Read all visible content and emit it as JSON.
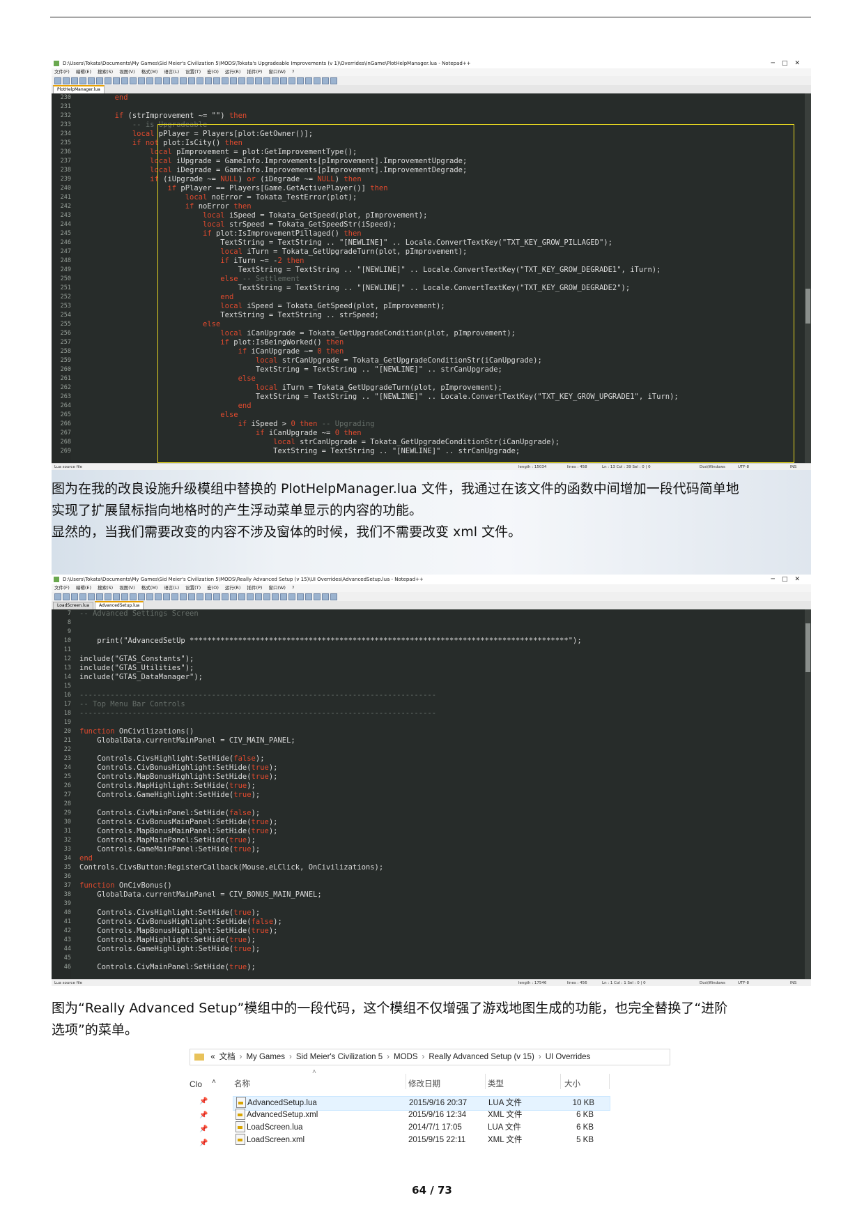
{
  "screenshot1": {
    "title": "D:\\Users\\Tokata\\Documents\\My Games\\Sid Meier's Civilization 5\\MODS\\Tokata's Upgradeable Improvements (v 1)\\Overrides\\InGame\\PlotHelpManager.lua - Notepad++",
    "menu": [
      "文件(F)",
      "编辑(E)",
      "搜索(S)",
      "视图(V)",
      "格式(M)",
      "语言(L)",
      "设置(T)",
      "宏(O)",
      "运行(R)",
      "插件(P)",
      "窗口(W)",
      "?"
    ],
    "tabs": [
      "PlotHelpManager.lua"
    ],
    "line_numbers": [
      "230",
      "231",
      "232",
      "233",
      "234",
      "235",
      "236",
      "237",
      "238",
      "239",
      "240",
      "241",
      "242",
      "243",
      "244",
      "245",
      "246",
      "247",
      "248",
      "249",
      "250",
      "251",
      "252",
      "253",
      "254",
      "255",
      "256",
      "257",
      "258",
      "259",
      "260",
      "261",
      "262",
      "263",
      "264",
      "265",
      "266",
      "267",
      "268",
      "269"
    ],
    "code": [
      "\t\tend",
      "",
      "\t\tif (strImprovement ~= \"\") then",
      "\t\t\t-- is Upgradeable",
      "\t\t\tlocal pPlayer = Players[plot:GetOwner()];",
      "\t\t\tif not plot:IsCity() then",
      "\t\t\t\tlocal pImprovement = plot:GetImprovementType();",
      "\t\t\t\tlocal iUpgrade = GameInfo.Improvements[pImprovement].ImprovementUpgrade;",
      "\t\t\t\tlocal iDegrade = GameInfo.Improvements[pImprovement].ImprovementDegrade;",
      "\t\t\t\tif (iUpgrade ~= NULL) or (iDegrade ~= NULL) then",
      "\t\t\t\t\tif pPlayer == Players[Game.GetActivePlayer()] then",
      "\t\t\t\t\t\tlocal noError = Tokata_TestError(plot);",
      "\t\t\t\t\t\tif noError then",
      "\t\t\t\t\t\t\tlocal iSpeed = Tokata_GetSpeed(plot, pImprovement);",
      "\t\t\t\t\t\t\tlocal strSpeed = Tokata_GetSpeedStr(iSpeed);",
      "\t\t\t\t\t\t\tif plot:IsImprovementPillaged() then",
      "\t\t\t\t\t\t\t\tTextString = TextString .. \"[NEWLINE]\" .. Locale.ConvertTextKey(\"TXT_KEY_GROW_PILLAGED\");",
      "\t\t\t\t\t\t\t\tlocal iTurn = Tokata_GetUpgradeTurn(plot, pImprovement);",
      "\t\t\t\t\t\t\t\tif iTurn ~= -2 then",
      "\t\t\t\t\t\t\t\t\tTextString = TextString .. \"[NEWLINE]\" .. Locale.ConvertTextKey(\"TXT_KEY_GROW_DEGRADE1\", iTurn);",
      "\t\t\t\t\t\t\t\telse -- Settlement",
      "\t\t\t\t\t\t\t\t\tTextString = TextString .. \"[NEWLINE]\" .. Locale.ConvertTextKey(\"TXT_KEY_GROW_DEGRADE2\");",
      "\t\t\t\t\t\t\t\tend",
      "\t\t\t\t\t\t\t\tlocal iSpeed = Tokata_GetSpeed(plot, pImprovement);",
      "\t\t\t\t\t\t\t\tTextString = TextString .. strSpeed;",
      "\t\t\t\t\t\t\telse",
      "\t\t\t\t\t\t\t\tlocal iCanUpgrade = Tokata_GetUpgradeCondition(plot, pImprovement);",
      "\t\t\t\t\t\t\t\tif plot:IsBeingWorked() then",
      "\t\t\t\t\t\t\t\t\tif iCanUpgrade ~= 0 then",
      "\t\t\t\t\t\t\t\t\t\tlocal strCanUpgrade = Tokata_GetUpgradeConditionStr(iCanUpgrade);",
      "\t\t\t\t\t\t\t\t\t\tTextString = TextString .. \"[NEWLINE]\" .. strCanUpgrade;",
      "\t\t\t\t\t\t\t\t\telse",
      "\t\t\t\t\t\t\t\t\t\tlocal iTurn = Tokata_GetUpgradeTurn(plot, pImprovement);",
      "\t\t\t\t\t\t\t\t\t\tTextString = TextString .. \"[NEWLINE]\" .. Locale.ConvertTextKey(\"TXT_KEY_GROW_UPGRADE1\", iTurn);",
      "\t\t\t\t\t\t\t\t\tend",
      "\t\t\t\t\t\t\t\telse",
      "\t\t\t\t\t\t\t\t\tif iSpeed > 0 then -- Upgrading",
      "\t\t\t\t\t\t\t\t\t\tif iCanUpgrade ~= 0 then",
      "\t\t\t\t\t\t\t\t\t\t\tlocal strCanUpgrade = Tokata_GetUpgradeConditionStr(iCanUpgrade);",
      "\t\t\t\t\t\t\t\t\t\t\tTextString = TextString .. \"[NEWLINE]\" .. strCanUpgrade;"
    ],
    "status": {
      "left": "Lua source file",
      "length": "length : 15034",
      "lines": "lines : 458",
      "pos": "Ln : 13    Col : 39    Sel : 0 | 0",
      "eol": "Dos\\Windows",
      "enc": "UTF-8",
      "mode": "INS"
    }
  },
  "caption1_line1": "图为在我的改良设施升级模组中替换的 PlotHelpManager.lua 文件，我通过在该文件的函数中间增加一段代码简单地",
  "caption1_line2": "实现了扩展鼠标指向地格时的产生浮动菜单显示的内容的功能。",
  "caption1_line3": "显然的，当我们需要改变的内容不涉及窗体的时候，我们不需要改变 xml 文件。",
  "screenshot2": {
    "title": "D:\\Users\\Tokata\\Documents\\My Games\\Sid Meier's Civilization 5\\MODS\\Really Advanced Setup (v 15)\\UI Overrides\\AdvancedSetup.lua - Notepad++",
    "menu": [
      "文件(F)",
      "编辑(E)",
      "搜索(S)",
      "视图(V)",
      "格式(M)",
      "语言(L)",
      "设置(T)",
      "宏(O)",
      "运行(R)",
      "插件(P)",
      "窗口(W)",
      "?"
    ],
    "tabs": [
      "LoadScreen.lua",
      "AdvancedSetup.lua"
    ],
    "line_numbers": [
      "7",
      "8",
      "9",
      "10",
      "11",
      "12",
      "13",
      "14",
      "15",
      "16",
      "17",
      "18",
      "19",
      "20",
      "21",
      "22",
      "23",
      "24",
      "25",
      "26",
      "27",
      "28",
      "29",
      "30",
      "31",
      "32",
      "33",
      "34",
      "35",
      "36",
      "37",
      "38",
      "39",
      "40",
      "41",
      "42",
      "43",
      "44",
      "45",
      "46"
    ],
    "code": [
      "-- Advanced Settings Screen",
      "",
      "",
      "\tprint(\"AdvancedSetUp **************************************************************************************\");",
      "",
      "include(\"GTAS_Constants\");",
      "include(\"GTAS_Utilities\");",
      "include(\"GTAS_DataManager\");",
      "",
      "---------------------------------------------------------------------------------",
      "-- Top Menu Bar Controls",
      "---------------------------------------------------------------------------------",
      "",
      "function OnCivilizations()",
      "\tGlobalData.currentMainPanel = CIV_MAIN_PANEL;",
      "",
      "\tControls.CivsHighlight:SetHide(false);",
      "\tControls.CivBonusHighlight:SetHide(true);",
      "\tControls.MapBonusHighlight:SetHide(true);",
      "\tControls.MapHighlight:SetHide(true);",
      "\tControls.GameHighlight:SetHide(true);",
      "",
      "\tControls.CivMainPanel:SetHide(false);",
      "\tControls.CivBonusMainPanel:SetHide(true);",
      "\tControls.MapBonusMainPanel:SetHide(true);",
      "\tControls.MapMainPanel:SetHide(true);",
      "\tControls.GameMainPanel:SetHide(true);",
      "end",
      "Controls.CivsButton:RegisterCallback(Mouse.eLClick, OnCivilizations);",
      "",
      "function OnCivBonus()",
      "\tGlobalData.currentMainPanel = CIV_BONUS_MAIN_PANEL;",
      "",
      "\tControls.CivsHighlight:SetHide(true);",
      "\tControls.CivBonusHighlight:SetHide(false);",
      "\tControls.MapBonusHighlight:SetHide(true);",
      "\tControls.MapHighlight:SetHide(true);",
      "\tControls.GameHighlight:SetHide(true);",
      "",
      "\tControls.CivMainPanel:SetHide(true);"
    ],
    "status": {
      "left": "Lua source file",
      "length": "length : 17546",
      "lines": "lines : 456",
      "pos": "Ln : 1    Col : 1    Sel : 0 | 0",
      "eol": "Dos\\Windows",
      "enc": "UTF-8",
      "mode": "INS"
    }
  },
  "caption2_line1": "图为“Really Advanced Setup”模组中的一段代码，这个模组不仅增强了游戏地图生成的功能，也完全替换了“进阶",
  "caption2_line2": "选项”的菜单。",
  "explorer": {
    "breadcrumb": [
      "«",
      "文档",
      "My Games",
      "Sid Meier's Civilization 5",
      "MODS",
      "Really Advanced Setup (v 15)",
      "UI Overrides"
    ],
    "nav_label": "Clo",
    "columns": [
      "名称",
      "修改日期",
      "类型",
      "大小"
    ],
    "files": [
      {
        "name": "AdvancedSetup.lua",
        "date": "2015/9/16 20:37",
        "type": "LUA 文件",
        "size": "10 KB"
      },
      {
        "name": "AdvancedSetup.xml",
        "date": "2015/9/16 12:34",
        "type": "XML 文件",
        "size": "6 KB"
      },
      {
        "name": "LoadScreen.lua",
        "date": "2014/7/1 17:05",
        "type": "LUA 文件",
        "size": "6 KB"
      },
      {
        "name": "LoadScreen.xml",
        "date": "2015/9/15 22:11",
        "type": "XML 文件",
        "size": "5 KB"
      }
    ]
  },
  "page_number": "64 / 73"
}
